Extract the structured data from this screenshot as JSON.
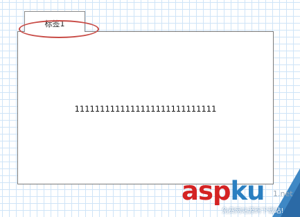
{
  "tab": {
    "label": "标签1"
  },
  "panel": {
    "content": "1111111111111111111111111111"
  },
  "watermark": {
    "logo_asp": "asp",
    "logo_ku": "ku",
    "suffix": "1.net",
    "subtitle": "免费网站源码下载站!"
  },
  "colors": {
    "highlight": "#c84a45",
    "grid": "#cfe4f7",
    "logo_red": "#d42323",
    "logo_blue": "#2a7fc1"
  }
}
